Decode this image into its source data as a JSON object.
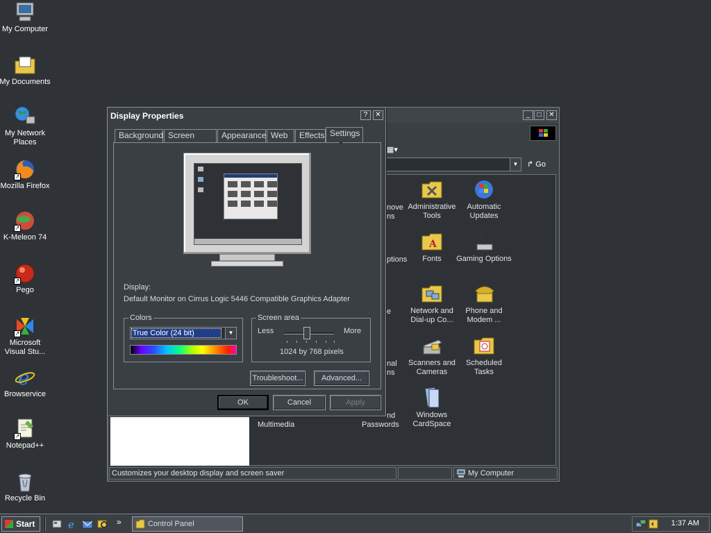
{
  "desktop": {
    "icons": [
      {
        "label": "My Computer",
        "icon": "computer-icon"
      },
      {
        "label": "My Documents",
        "icon": "folder-documents-icon"
      },
      {
        "label": "My Network Places",
        "icon": "network-icon"
      },
      {
        "label": "Mozilla Firefox",
        "icon": "firefox-icon"
      },
      {
        "label": "K-Meleon 74",
        "icon": "kmeleon-icon"
      },
      {
        "label": "Pego",
        "icon": "pego-icon"
      },
      {
        "label": "Microsoft Visual Stu...",
        "icon": "visual-studio-icon"
      },
      {
        "label": "Browservice",
        "icon": "internet-explorer-icon"
      },
      {
        "label": "Notepad++",
        "icon": "notepad-icon"
      },
      {
        "label": "Recycle Bin",
        "icon": "recycle-bin-icon"
      }
    ]
  },
  "control_panel": {
    "title": "Control Panel",
    "go_label": "Go",
    "items": [
      {
        "label": "Administrative Tools",
        "icon": "admin-tools-icon"
      },
      {
        "label": "Automatic Updates",
        "icon": "windows-update-icon"
      },
      {
        "label": "Fonts",
        "icon": "fonts-folder-icon"
      },
      {
        "label": "Gaming Options",
        "icon": "joystick-icon"
      },
      {
        "label": "Network and Dial-up Co...",
        "icon": "network-connections-icon"
      },
      {
        "label": "Phone and Modem ...",
        "icon": "phone-icon"
      },
      {
        "label": "Scanners and Cameras",
        "icon": "scanner-icon"
      },
      {
        "label": "Scheduled Tasks",
        "icon": "scheduled-tasks-icon"
      },
      {
        "label": "Windows CardSpace",
        "icon": "cardspace-icon"
      }
    ],
    "partial_labels": {
      "remove_1": "nove",
      "remove_2": "ns",
      "options": "ptions",
      "e": "e",
      "nal": "nal",
      "ns2": "ns",
      "multimedia": "Multimedia",
      "nd": "nd",
      "passwords": "Passwords"
    },
    "status": {
      "text": "Customizes your desktop display and screen saver",
      "zone": "My Computer"
    }
  },
  "dialog": {
    "title": "Display Properties",
    "help_label": "?",
    "close_label": "✕",
    "tabs": [
      "Background",
      "Screen Saver",
      "Appearance",
      "Web",
      "Effects",
      "Settings"
    ],
    "active_tab": "Settings",
    "display_label": "Display:",
    "display_value": "Default Monitor on Cirrus Logic 5446 Compatible Graphics Adapter",
    "colors": {
      "legend": "Colors",
      "selected": "True Color (24 bit)"
    },
    "screen_area": {
      "legend": "Screen area",
      "less": "Less",
      "more": "More",
      "value": "1024 by 768 pixels"
    },
    "troubleshoot_label": "Troubleshoot...",
    "advanced_label": "Advanced...",
    "ok_label": "OK",
    "cancel_label": "Cancel",
    "apply_label": "Apply"
  },
  "taskbar": {
    "start_label": "Start",
    "task_label": "Control Panel",
    "chevron": "»",
    "clock": "1:37 AM"
  }
}
